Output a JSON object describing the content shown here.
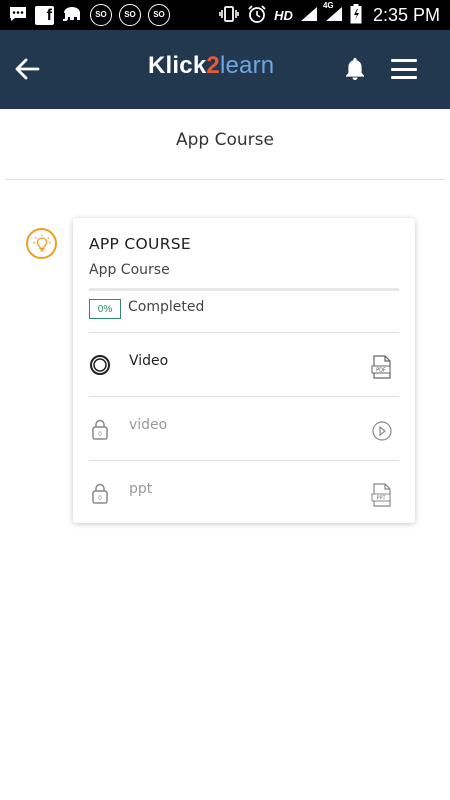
{
  "status_bar": {
    "network_label": "HD",
    "signal_type": "4G",
    "time": "2:35 PM",
    "notification_icons": [
      "chat-icon",
      "facebook-icon",
      "elephant-icon",
      "so-icon",
      "so-icon",
      "so-icon"
    ]
  },
  "header": {
    "logo": {
      "part1": "Klick",
      "part2": "2",
      "part3": "learn"
    },
    "background_color": "#22384f"
  },
  "page": {
    "title": "App Course"
  },
  "course": {
    "title": "APP COURSE",
    "subtitle": "App Course",
    "progress_percent": 0,
    "progress_badge": "0%",
    "progress_label": "Completed",
    "items": [
      {
        "label": "Video",
        "status": "active",
        "left_icon": "progress-ring-icon",
        "right_icon": "pdf-file-icon"
      },
      {
        "label": "video",
        "status": "locked",
        "left_icon": "lock-icon",
        "right_icon": "play-circle-icon"
      },
      {
        "label": "ppt",
        "status": "locked",
        "left_icon": "lock-icon",
        "right_icon": "ppt-file-icon"
      }
    ]
  },
  "colors": {
    "accent_green": "#2e8b6c",
    "bulb_orange": "#f0a020"
  }
}
